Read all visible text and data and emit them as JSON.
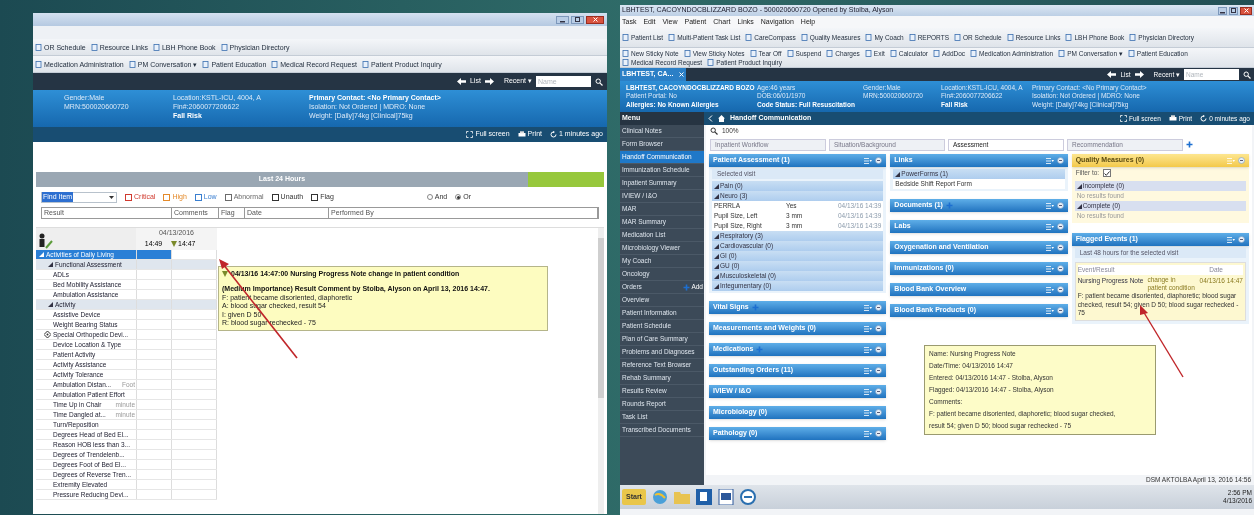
{
  "left_window": {
    "toolbar_rows": [
      [
        "OR Schedule",
        "Resource Links",
        "LBH Phone Book",
        "Physician Directory"
      ],
      [
        "Medication Administration",
        "PM Conversation ▾",
        "Patient Education",
        "Medical Record Request",
        "Patient Product Inquiry"
      ]
    ],
    "nav": {
      "list": "List",
      "recent": "Recent ▾",
      "search_placeholder": "Name"
    },
    "banner_columns": [
      {
        "lines": [
          "Gender:Male",
          "MRN:500020600720"
        ]
      },
      {
        "lines": [
          "Location:KSTL-ICU, 4004, A",
          "Fin#:2060077206622"
        ],
        "alert": "Fall Risk"
      },
      {
        "title": "Primary Contact: <No Primary Contact>",
        "lines": [
          "Isolation: Not Ordered | MDRO: None",
          "Weight: [Daily]74kg [Clinical]75kg"
        ]
      }
    ],
    "actions": [
      "Full screen",
      "Print",
      "1 minutes ago"
    ],
    "time_bar": "Last 24 Hours",
    "filter": {
      "find_value": "Find Item",
      "checkboxes": [
        {
          "label": "Critical",
          "checked": false,
          "color": "#d03a2f"
        },
        {
          "label": "High",
          "checked": false,
          "color": "#e48a2a"
        },
        {
          "label": "Low",
          "checked": false,
          "color": "#3a7fd0"
        },
        {
          "label": "Abnormal",
          "checked": false,
          "color": "#6b6b6b"
        },
        {
          "label": "Unauth",
          "checked": false,
          "color": "#333333"
        },
        {
          "label": "Flag",
          "checked": false,
          "color": "#333333"
        }
      ],
      "radios": [
        {
          "label": "And",
          "selected": false
        },
        {
          "label": "Or",
          "selected": true
        }
      ]
    },
    "columns": [
      "Result",
      "Comments",
      "Flag",
      "Date",
      "Performed By"
    ],
    "grid": {
      "date": "04/13/2016",
      "times": [
        "14:49",
        "14:47"
      ],
      "rows": [
        {
          "label": "Activities of Daily Living",
          "kind": "section",
          "selected": true
        },
        {
          "label": "Functional Assessment",
          "kind": "group",
          "selected": false
        },
        {
          "label": "ADLs",
          "kind": "item",
          "selected": false
        },
        {
          "label": "Bed Mobility Assistance",
          "kind": "item",
          "selected": false
        },
        {
          "label": "Ambulation Assistance",
          "kind": "item",
          "selected": false
        },
        {
          "label": "Activity",
          "kind": "group",
          "selected": false
        },
        {
          "label": "Assistive Device",
          "kind": "item",
          "selected": false
        },
        {
          "label": "Weight Bearing Status",
          "kind": "item",
          "selected": false
        },
        {
          "label": "Special Orthopedic Devi...",
          "kind": "flagged",
          "selected": false
        },
        {
          "label": "Device Location & Type",
          "kind": "item",
          "selected": false
        },
        {
          "label": "Patient Activity",
          "kind": "item",
          "selected": false
        },
        {
          "label": "Activity Assistance",
          "kind": "item",
          "selected": false
        },
        {
          "label": "Activity Tolerance",
          "kind": "item",
          "selected": false
        },
        {
          "label": "Ambulation Distan...",
          "kind": "item",
          "selected": false,
          "hint": "Foot"
        },
        {
          "label": "Ambulation Patient Effort",
          "kind": "item",
          "selected": false
        },
        {
          "label": "Time Up in Chair",
          "kind": "item",
          "selected": false,
          "hint": "minute"
        },
        {
          "label": "Time Dangled at...",
          "kind": "item",
          "selected": false,
          "hint": "minute"
        },
        {
          "label": "Turn/Reposition",
          "kind": "item",
          "selected": false
        },
        {
          "label": "Degrees Head of Bed El...",
          "kind": "item",
          "selected": false
        },
        {
          "label": "Reason HOB less than 3...",
          "kind": "item",
          "selected": false
        },
        {
          "label": "Degrees of Trendelenb...",
          "kind": "item",
          "selected": false
        },
        {
          "label": "Degrees Foot of Bed El...",
          "kind": "item",
          "selected": false
        },
        {
          "label": "Degrees of Reverse Tren...",
          "kind": "item",
          "selected": false
        },
        {
          "label": "Extremity Elevated",
          "kind": "item",
          "selected": false
        },
        {
          "label": "Pressure Reducing Devi...",
          "kind": "item",
          "selected": false
        }
      ]
    },
    "tooltip": {
      "title": "04/13/16 14:47:00 Nursing Progress Note change in patient condition",
      "heading": "(Medium Importance) Result Comment by Stolba, Alyson on April 13, 2016 14:47.",
      "lines": [
        "F: patient became disoriented, diaphoretic",
        "A: blood sugar checked, result 54",
        "I: given D 50",
        "R: blood sugar rechecked - 75"
      ]
    }
  },
  "right_window": {
    "title": "LBHTEST, CACOYNDOCBLIZZARD BOZO - 500020600720 Opened by Stolba, Alyson",
    "menu": [
      "Task",
      "Edit",
      "View",
      "Patient",
      "Chart",
      "Links",
      "Navigation",
      "Help"
    ],
    "toolbar_rows": [
      [
        "Patient List",
        "Multi-Patient Task List",
        "CareCompass",
        "Quality Measures",
        "My Coach",
        "REPORTS",
        "OR Schedule",
        "Resource Links",
        "LBH Phone Book",
        "Physician Directory"
      ],
      [
        "New Sticky Note",
        "View Sticky Notes",
        "Tear Off",
        "Suspend",
        "Charges",
        "Exit",
        "Calculator",
        "AddDoc",
        "Medication Administration",
        "PM Conversation ▾",
        "Patient Education",
        "Medical Record Request",
        "Patient Product Inquiry"
      ]
    ],
    "patient_tab": "LBHTEST, CA...",
    "nav": {
      "list": "List",
      "recent": "Recent ▾",
      "search_placeholder": "Name"
    },
    "banner_columns": [
      {
        "title": "LBHTEST, CACOYNDOCBLIZZARD BOZO",
        "lines": [
          "Patient Portal: No"
        ],
        "alert": "Allergies: No Known Allergies"
      },
      {
        "lines": [
          "Age:46 years",
          "DOB:06/01/1970"
        ],
        "alert": "Code Status: Full Resuscitation"
      },
      {
        "lines": [
          "Gender:Male",
          "MRN:500020600720"
        ]
      },
      {
        "lines": [
          "Location:KSTL-ICU, 4004, A",
          "Fin#:2060077206622"
        ],
        "alert": "Fall Risk"
      },
      {
        "lines": [
          "Primary Contact: <No Primary Contact>",
          "Isolation: Not Ordered | MDRO: None",
          "Weight: [Daily]74kg [Clinical]75kg"
        ]
      }
    ],
    "sidebar": {
      "title": "Menu",
      "items": [
        {
          "label": "Clinical Notes",
          "selected": false
        },
        {
          "label": "Form Browser",
          "selected": false
        },
        {
          "label": "Handoff Communication",
          "selected": true
        },
        {
          "label": "Immunization Schedule",
          "selected": false
        },
        {
          "label": "Inpatient Summary",
          "selected": false
        },
        {
          "label": "IVIEW / I&O",
          "selected": false
        },
        {
          "label": "MAR",
          "selected": false
        },
        {
          "label": "MAR Summary",
          "selected": false
        },
        {
          "label": "Medication List",
          "selected": false
        },
        {
          "label": "Microbiology Viewer",
          "selected": false
        },
        {
          "label": "My Coach",
          "selected": false
        },
        {
          "label": "Oncology",
          "selected": false
        },
        {
          "label": "Orders",
          "selected": false,
          "action": "Add"
        },
        {
          "label": "Overview",
          "selected": false
        },
        {
          "label": "Patient Information",
          "selected": false
        },
        {
          "label": "Patient Schedule",
          "selected": false
        },
        {
          "label": "Plan of Care Summary",
          "selected": false
        },
        {
          "label": "Problems and Diagnoses",
          "selected": false
        },
        {
          "label": "Reference Text Browser",
          "selected": false
        },
        {
          "label": "Rehab Summary",
          "selected": false
        },
        {
          "label": "Results Review",
          "selected": false
        },
        {
          "label": "Rounds Report",
          "selected": false
        },
        {
          "label": "Task List",
          "selected": false
        },
        {
          "label": "Transcribed Documents",
          "selected": false
        }
      ]
    },
    "page_header": {
      "title": "Handoff Communication",
      "actions": [
        "Full screen",
        "Print",
        "0 minutes ago"
      ]
    },
    "zoom": "100%",
    "tabs": [
      {
        "label": "Inpatient Workflow",
        "selected": false
      },
      {
        "label": "Situation/Background",
        "selected": false
      },
      {
        "label": "Assessment",
        "selected": true
      },
      {
        "label": "Recommendation",
        "selected": false
      }
    ],
    "columns": [
      [
        {
          "title": "Patient Assessment (1)",
          "kind": "blue",
          "plus": false,
          "rows": [
            {
              "kind": "subtitle",
              "cells": [
                "Selected visit"
              ]
            },
            {
              "kind": "group",
              "cells": [
                "Pain (0)"
              ]
            },
            {
              "kind": "group",
              "cells": [
                "Neuro (3)"
              ]
            },
            {
              "kind": "result",
              "cells": [
                "PERRLA",
                "Yes",
                "04/13/16 14:39"
              ]
            },
            {
              "kind": "result",
              "cells": [
                "Pupil Size, Left",
                "3 mm",
                "04/13/16 14:39"
              ]
            },
            {
              "kind": "result",
              "cells": [
                "Pupil Size, Right",
                "3 mm",
                "04/13/16 14:39"
              ]
            },
            {
              "kind": "group",
              "cells": [
                "Respiratory (3)"
              ]
            },
            {
              "kind": "group",
              "cells": [
                "Cardiovascular (0)"
              ]
            },
            {
              "kind": "group",
              "cells": [
                "GI (0)"
              ]
            },
            {
              "kind": "group",
              "cells": [
                "GU (0)"
              ]
            },
            {
              "kind": "group",
              "cells": [
                "Musculoskeletal (0)"
              ]
            },
            {
              "kind": "group",
              "cells": [
                "Integumentary (0)"
              ]
            }
          ]
        },
        {
          "title": "Vital Signs",
          "kind": "blue",
          "plus": true
        },
        {
          "title": "Measurements and Weights (0)",
          "kind": "blue",
          "plus": false
        },
        {
          "title": "Medications",
          "kind": "blue",
          "plus": true
        },
        {
          "title": "Outstanding Orders (11)",
          "kind": "blue",
          "plus": false
        },
        {
          "title": "IVIEW / I&O",
          "kind": "blue",
          "plus": false
        },
        {
          "title": "Microbiology (0)",
          "kind": "blue",
          "plus": false
        },
        {
          "title": "Pathology (0)",
          "kind": "blue",
          "plus": false
        }
      ],
      [
        {
          "title": "Links",
          "kind": "blue",
          "plus": false,
          "rows": [
            {
              "kind": "group",
              "cells": [
                "PowerForms (1)"
              ]
            },
            {
              "kind": "result",
              "cells": [
                "Bedside Shift Report Form"
              ]
            }
          ]
        },
        {
          "title": "Documents (1)",
          "kind": "blue",
          "plus": true
        },
        {
          "title": "Labs",
          "kind": "blue",
          "plus": false
        },
        {
          "title": "Oxygenation and Ventilation",
          "kind": "blue",
          "plus": false
        },
        {
          "title": "Immunizations (0)",
          "kind": "blue",
          "plus": false
        },
        {
          "title": "Blood Bank Overview",
          "kind": "blue",
          "plus": false
        },
        {
          "title": "Blood Bank Products (0)",
          "kind": "blue",
          "plus": false
        }
      ],
      [
        {
          "title": "Quality Measures (0)",
          "kind": "yellow",
          "plus": false,
          "filter": {
            "label": "Filter to:",
            "checked": true
          },
          "rows": [
            {
              "kind": "group",
              "cells": [
                "Incomplete (0)"
              ]
            },
            {
              "kind": "empty",
              "cells": [
                "No results found"
              ]
            },
            {
              "kind": "group",
              "cells": [
                "Complete (0)"
              ]
            },
            {
              "kind": "empty",
              "cells": [
                "No results found"
              ]
            }
          ]
        },
        {
          "title": "Flagged Events (1)",
          "kind": "blue",
          "plus": false,
          "rows": [
            {
              "kind": "subtitle",
              "cells": [
                "Last 48 hours for the selected visit"
              ]
            }
          ],
          "events": {
            "header": [
              "Event/Result",
              "Date"
            ],
            "row": [
              "Nursing Progress Note",
              "change in patient condition",
              "04/13/16 14:47"
            ],
            "note": "F: patient became disoriented, diaphoretic; blood sugar checked, result 54; given D 50; blood sugar rechecked - 75"
          }
        }
      ]
    ],
    "tooltip": [
      "Name: Nursing Progress Note",
      "Date/Time: 04/13/2016 14:47",
      "Entered: 04/13/2016 14:47 - Stolba, Alyson",
      "Flagged: 04/13/2016 14:47 - Stolba, Alyson",
      "Comments:",
      "F: patient became disoriented, diaphoretic; blood sugar checked,",
      "result 54; given D 50; blood sugar rechecked - 75"
    ],
    "status": "DSM AKTOLBA April 13, 2016 14:56",
    "taskbar": {
      "start": "Start",
      "time": "2:56 PM",
      "date": "4/13/2016"
    }
  }
}
